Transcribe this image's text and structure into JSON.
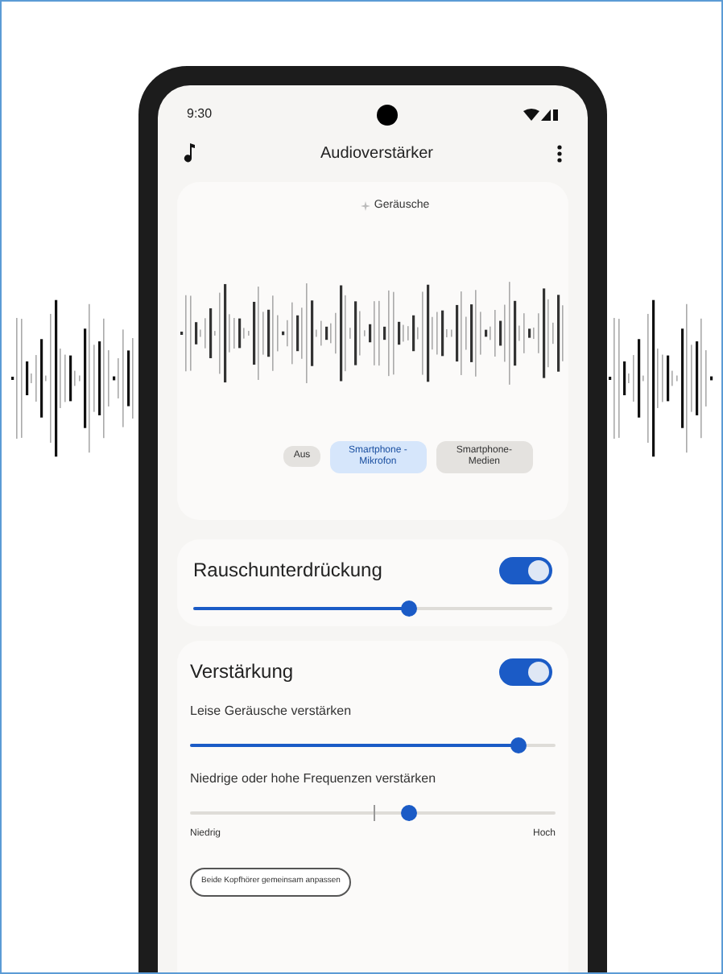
{
  "status_bar": {
    "time": "9:30"
  },
  "app_bar": {
    "title": "Audioverstärker"
  },
  "sound_card": {
    "label": "Geräusche",
    "modes": [
      {
        "label": "Aus",
        "selected": false
      },
      {
        "label": "Smartphone -Mikrofon",
        "selected": true
      },
      {
        "label": "Smartphone-Medien",
        "selected": false
      }
    ]
  },
  "noise_card": {
    "title": "Rauschunterdrückung",
    "on": true,
    "level": 0.6
  },
  "amplify_card": {
    "title": "Verstärkung",
    "on": true,
    "sliders": [
      {
        "kind": "fill",
        "label": "Leise Geräusche verstärken",
        "level": 0.9
      },
      {
        "kind": "centered",
        "label": "Niedrige oder hohe Frequenzen verstärken",
        "level": 0.6,
        "min_label": "Niedrig",
        "max_label": "Hoch"
      }
    ],
    "button": "Beide Kopfhörer gemeinsam anpassen"
  }
}
